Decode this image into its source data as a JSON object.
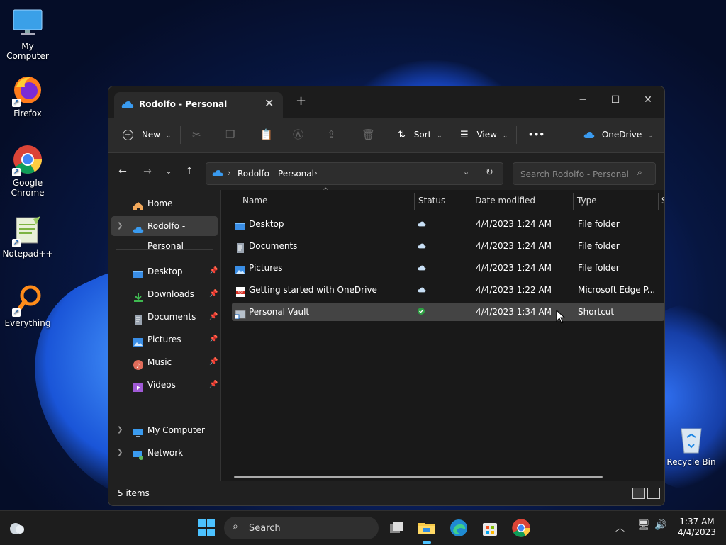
{
  "desktop": {
    "icons": [
      {
        "label": "My Computer"
      },
      {
        "label": "Firefox"
      },
      {
        "label": "Google Chrome"
      },
      {
        "label": "Notepad++"
      },
      {
        "label": "Everything"
      },
      {
        "label": "Recycle Bin"
      }
    ]
  },
  "window": {
    "tab_title": "Rodolfo - Personal",
    "controls": {
      "minimize": "─",
      "maximize": "☐",
      "close": "✕"
    }
  },
  "toolbar": {
    "new_label": "New",
    "sort_label": "Sort",
    "view_label": "View",
    "more_label": "•••",
    "onedrive_label": "OneDrive"
  },
  "address": {
    "path": "Rodolfo - Personal",
    "search_placeholder": "Search Rodolfo - Personal"
  },
  "nav": {
    "home": "Home",
    "current": "Rodolfo - Personal",
    "quick_access": [
      {
        "label": "Desktop"
      },
      {
        "label": "Downloads"
      },
      {
        "label": "Documents"
      },
      {
        "label": "Pictures"
      },
      {
        "label": "Music"
      },
      {
        "label": "Videos"
      }
    ],
    "computer": "My Computer",
    "network": "Network"
  },
  "columns": {
    "name": "Name",
    "status": "Status",
    "date": "Date modified",
    "type": "Type",
    "size_partial": "S"
  },
  "files": [
    {
      "name": "Desktop",
      "date": "4/4/2023 1:24 AM",
      "type": "File folder",
      "status": "cloud"
    },
    {
      "name": "Documents",
      "date": "4/4/2023 1:24 AM",
      "type": "File folder",
      "status": "cloud"
    },
    {
      "name": "Pictures",
      "date": "4/4/2023 1:24 AM",
      "type": "File folder",
      "status": "cloud"
    },
    {
      "name": "Getting started with OneDrive",
      "date": "4/4/2023 1:22 AM",
      "type": "Microsoft Edge P...",
      "status": "cloud"
    },
    {
      "name": "Personal Vault",
      "date": "4/4/2023 1:34 AM",
      "type": "Shortcut",
      "status": "synced"
    }
  ],
  "statusbar": {
    "item_count": "5 items"
  },
  "taskbar": {
    "search_label": "Search",
    "time": "1:37 AM",
    "date": "4/4/2023"
  },
  "colors": {
    "accent": "#0078d4",
    "folder": "#3a8ee6",
    "window_bg": "#202020",
    "synced": "#2ea043"
  }
}
